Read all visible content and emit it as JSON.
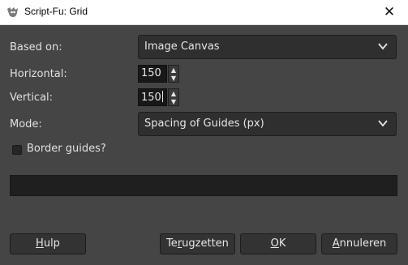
{
  "window": {
    "title": "Script-Fu: Grid",
    "close_glyph": "✕"
  },
  "form": {
    "based_on": {
      "label": "Based on:",
      "value": "Image Canvas"
    },
    "horizontal": {
      "label": "Horizontal:",
      "value": "150"
    },
    "vertical": {
      "label": "Vertical:",
      "value": "150"
    },
    "mode": {
      "label": "Mode:",
      "value": "Spacing of Guides (px)"
    },
    "border_guides": {
      "label": "Border guides?",
      "checked": false
    }
  },
  "progress": {
    "value": 0
  },
  "buttons": {
    "help": {
      "mnemonic": "H",
      "rest": "ulp"
    },
    "reset": {
      "pre": "Te",
      "mnemonic": "r",
      "rest": "ugzetten"
    },
    "ok": {
      "mnemonic": "O",
      "rest": "K"
    },
    "cancel": {
      "mnemonic": "A",
      "rest": "nnuleren"
    }
  },
  "colors": {
    "background": "#454545",
    "field": "#2f2f2f",
    "spin_field": "#181818",
    "button": "#333333"
  }
}
